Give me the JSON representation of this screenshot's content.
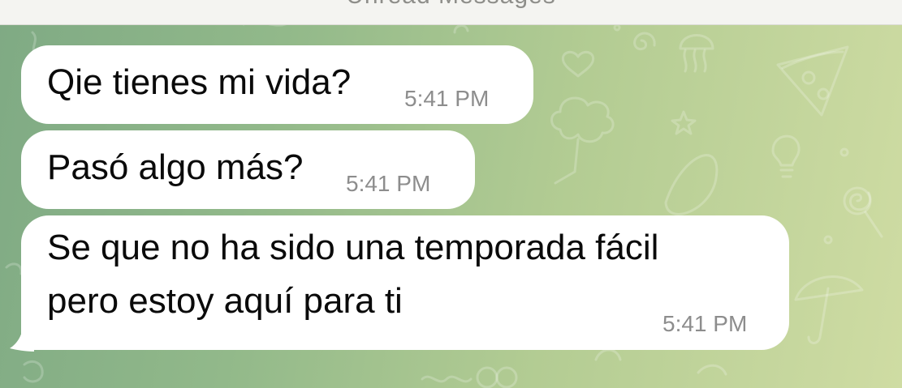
{
  "header": {
    "unread_label": "Unread Messages"
  },
  "messages": [
    {
      "text": "Qie tienes mi vida?",
      "time": "5:41 PM"
    },
    {
      "text": "Pasó algo más?",
      "time": "5:41 PM"
    },
    {
      "lines": [
        "Se que no ha sido una temporada fácil",
        "pero estoy aquí para ti"
      ],
      "time": "5:41 PM"
    }
  ],
  "colors": {
    "bubble": "#ffffff",
    "text": "#0a0a0a",
    "time": "#8d8d8d",
    "wallpaper_left": "#7faa84",
    "wallpaper_right": "#cfdca3"
  }
}
